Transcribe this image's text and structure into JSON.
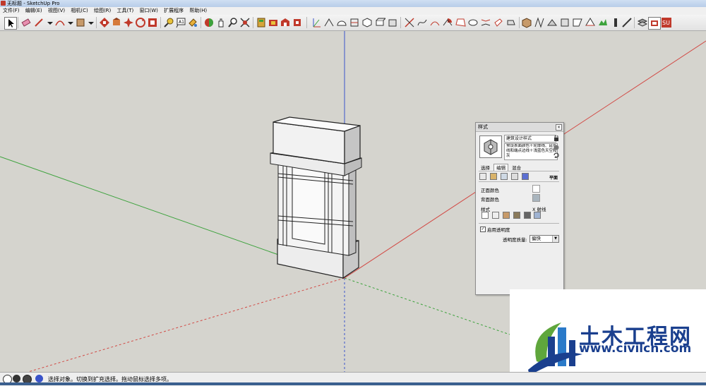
{
  "window": {
    "title": "无标题 - SketchUp Pro"
  },
  "menu": [
    "文件(F)",
    "编辑(E)",
    "视图(V)",
    "相机(C)",
    "绘图(R)",
    "工具(T)",
    "窗口(W)",
    "扩展程序",
    "帮助(H)"
  ],
  "toolbar": {
    "tools": [
      "select-icon",
      "eraser-icon",
      "pencil-icon",
      "arc-icon",
      "rectangle-icon",
      "pushpull-icon",
      "move-icon",
      "rotate-icon",
      "scale-icon",
      "offset-icon",
      "tape-icon",
      "text-icon",
      "paint-icon",
      "orbit-icon",
      "pan-icon",
      "zoom-icon",
      "zoom-extents-icon",
      "warehouse-icon",
      "components-icon",
      "extension-icon"
    ]
  },
  "status": {
    "text": "选择对象。切换到扩充选择。拖动鼠标选择多项。"
  },
  "styles_panel": {
    "title": "样式",
    "style_name": "建筑设计样式",
    "style_desc": "预设表面颜色＋轮廓线、延长线和端点边线＋浅蓝色天空和灰",
    "tabs": [
      "选择",
      "编辑",
      "混合"
    ],
    "view_label": "平面",
    "front_color_label": "正面颜色",
    "back_color_label": "背面颜色",
    "style_label": "样式",
    "xray_label": "X 射线",
    "transparency_label": "启用透明度",
    "transparency_quality_label": "透明度质量:",
    "transparency_quality_value": "偏快",
    "colors": {
      "front": "#ffffff",
      "back": "#a9b5be"
    }
  },
  "watermark": {
    "title": "土木工程网",
    "url": "www.civilcn.com"
  },
  "colors": {
    "accent_red": "#c8312c",
    "axis_green": "#3ca23c",
    "axis_blue": "#3a53c9",
    "axis_red": "#d24a45",
    "watermark_blue": "#1a3f8e"
  }
}
